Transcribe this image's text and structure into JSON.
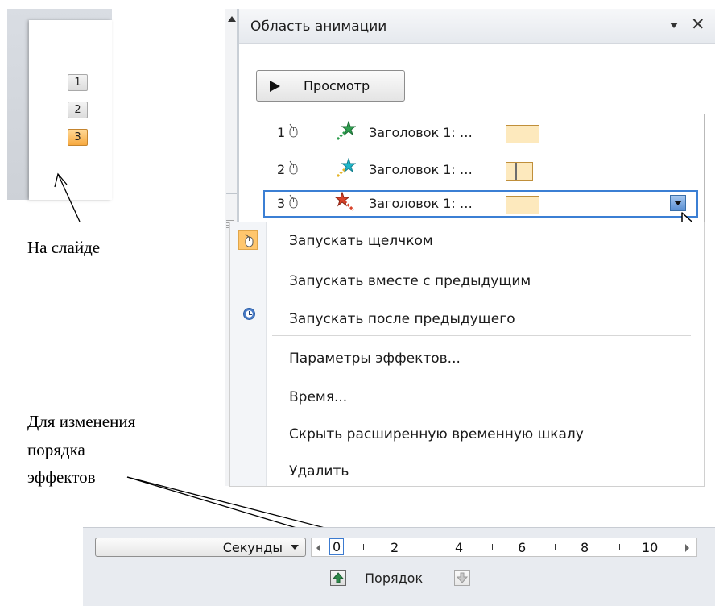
{
  "slide_thumbnail": {
    "numbers": [
      "1",
      "2",
      "3"
    ],
    "active_index": 2
  },
  "annotations": {
    "on_slide": "На слайде",
    "reorder": [
      "Для изменения",
      "порядка",
      "эффектов"
    ]
  },
  "pane": {
    "title": "Область анимации",
    "preview_label": "Просмотр"
  },
  "animations": [
    {
      "num": "1",
      "label": "Заголовок 1: …",
      "star_color": "#2e9e4f"
    },
    {
      "num": "2",
      "label": "Заголовок 1: …",
      "star_color": "#1fb6c9"
    },
    {
      "num": "3",
      "label": "Заголовок 1: …",
      "star_color": "#d8432b"
    }
  ],
  "context_menu": {
    "start_on_click": "Запускать щелчком",
    "start_with_previous": "Запускать вместе с предыдущим",
    "start_after_previous": "Запускать после предыдущего",
    "effect_options": "Параметры эффектов...",
    "timing": "Время...",
    "hide_timeline": "Скрыть расширенную временную шкалу",
    "remove": "Удалить"
  },
  "bottom_bar": {
    "seconds_label": "Секунды",
    "ruler_ticks": [
      "0",
      "2",
      "4",
      "6",
      "8",
      "10"
    ],
    "order_label": "Порядок"
  },
  "colors": {
    "selection": "#3b7fd4",
    "timing_fill": "#fde9bd",
    "highlight": "#ffc66d"
  }
}
